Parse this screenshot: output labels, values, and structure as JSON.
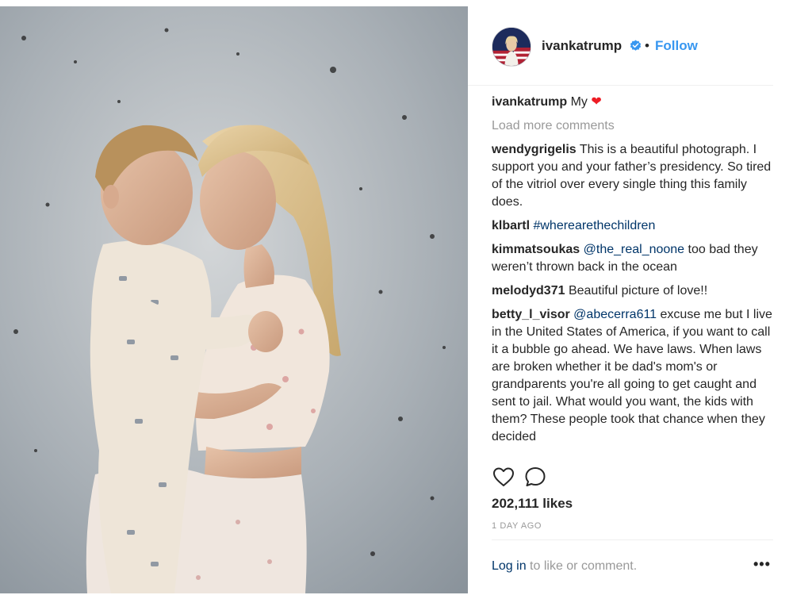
{
  "post": {
    "username": "ivankatrump",
    "separator": "•",
    "follow_label": "Follow",
    "caption": {
      "user": "ivankatrump",
      "text": "My",
      "heart": "❤"
    },
    "load_more_label": "Load more comments",
    "comments": [
      {
        "user": "wendygrigelis",
        "text": "This is a beautiful photograph. I support you and your father’s presidency. So tired of the vitriol over every single thing this family does."
      },
      {
        "user": "klbartl",
        "tag": "#wherearethechildren",
        "text": ""
      },
      {
        "user": "kimmatsoukas",
        "tag": "@the_real_noone",
        "text": "too bad they weren’t thrown back in the ocean"
      },
      {
        "user": "melodyd371",
        "text": "Beautiful picture of love!!"
      },
      {
        "user": "betty_l_visor",
        "tag": "@abecerra611",
        "text": "excuse me but I live in the United States of America, if you want to call it a bubble go ahead. We have laws. When laws are broken whether it be dad's mom's or grandparents you're all going to get caught and sent to jail. What would you want, the kids with them? These people took that chance when they decided"
      }
    ],
    "likes": "202,111 likes",
    "time": "1 DAY AGO",
    "footer": {
      "login_label": "Log in",
      "rest": " to like or comment."
    },
    "more_label": "•••",
    "icons": {
      "like": "heart-outline-icon",
      "comment": "speech-bubble-icon",
      "verified": "verified-badge-icon"
    },
    "colors": {
      "accent": "#3897f0",
      "link": "#003569",
      "muted": "#999999",
      "heart": "#ed1c24"
    }
  }
}
